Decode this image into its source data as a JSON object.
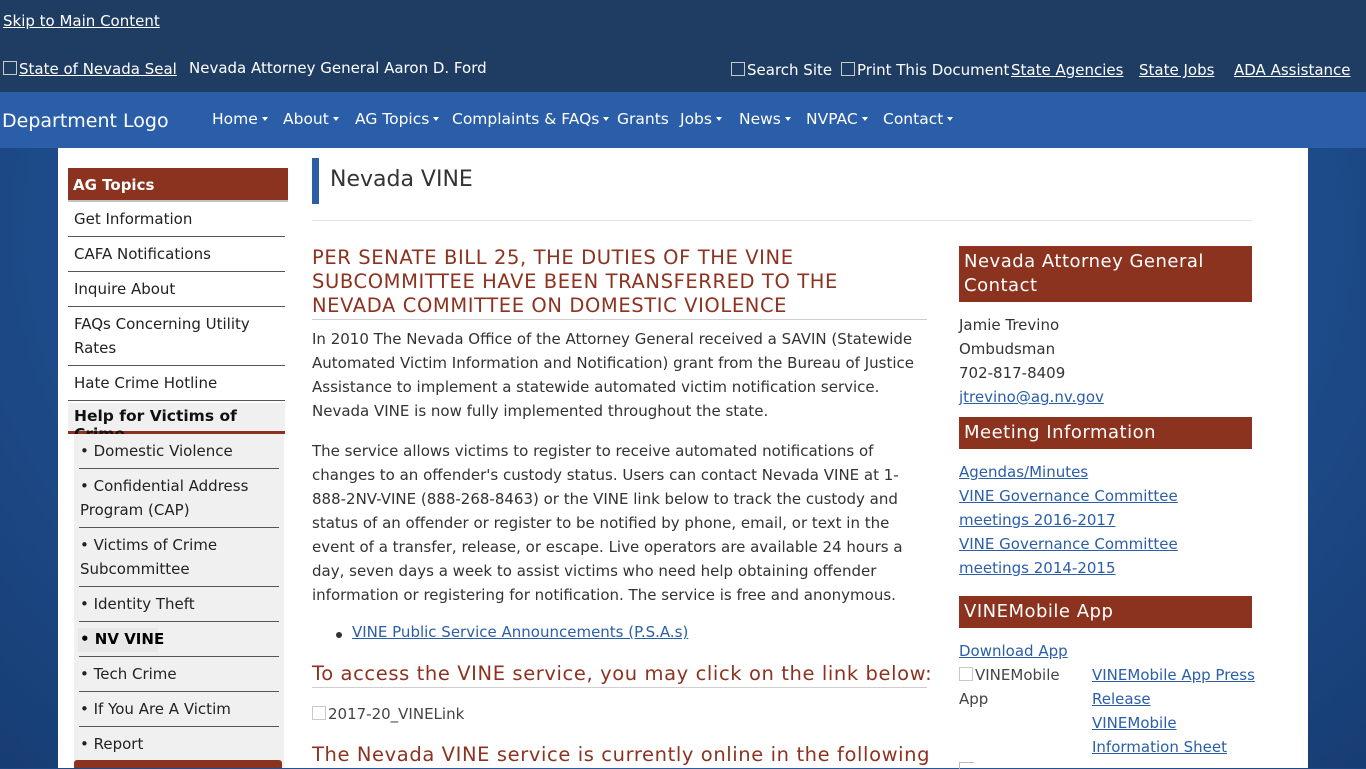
{
  "header": {
    "skip_link": "Skip to Main Content",
    "seal_alt": "State of Nevada Seal",
    "ag_title": "Nevada Attorney General Aaron D. Ford",
    "utilities": {
      "search_alt": "Search Site",
      "print_alt": "Print This Document",
      "state_agencies": "State Agencies",
      "state_jobs": "State Jobs",
      "ada": "ADA Assistance"
    }
  },
  "nav": {
    "logo_alt": "Department Logo",
    "items": [
      {
        "label": "Home"
      },
      {
        "label": "About"
      },
      {
        "label": "AG Topics"
      },
      {
        "label": "Complaints & FAQs"
      },
      {
        "label": "Grants"
      },
      {
        "label": "Jobs"
      },
      {
        "label": "News"
      },
      {
        "label": "NVPAC"
      },
      {
        "label": "Contact"
      }
    ]
  },
  "sidebar": {
    "heading": "AG Topics",
    "items": [
      {
        "label": "Get Information"
      },
      {
        "label": "CAFA Notifications"
      },
      {
        "label": "Inquire About"
      },
      {
        "label": "FAQs Concerning Utility Rates"
      },
      {
        "label": "Hate Crime Hotline"
      }
    ],
    "sub_heading": "Help for Victims of Crime",
    "sub_items": [
      {
        "label": "• Domestic Violence"
      },
      {
        "label": "• Confidential Address Program (CAP)"
      },
      {
        "label": "• Victims of Crime Subcommittee"
      },
      {
        "label": "• Identity Theft"
      },
      {
        "label": "• NV VINE"
      },
      {
        "label": "• Tech Crime"
      },
      {
        "label": "• If You Are A Victim"
      },
      {
        "label": "• Report"
      }
    ]
  },
  "main": {
    "page_title": "Nevada VINE",
    "heading": "PER SENATE BILL 25, THE DUTIES OF THE VINE SUBCOMMITTEE HAVE BEEN TRANSFERRED TO THE NEVADA COMMITTEE ON DOMESTIC VIOLENCE",
    "para1": "In 2010 The Nevada Office of the Attorney General received a SAVIN (Statewide Automated Victim Information and Notification) grant from the Bureau of Justice Assistance to implement a statewide automated victim notification service. Nevada VINE is now fully implemented throughout the state.",
    "para2": "The service allows victims to register to receive automated notifications of changes to an offender's custody status. Users can contact Nevada VINE at 1-888-2NV-VINE (888-268-8463) or the VINE link below to track the custody and status of an offender or register to be notified by phone, email, or text in the event of a transfer, release, or escape. Live operators are available 24 hours a day, seven days a week to assist victims who need help obtaining offender information or registering for notification. The service is free and anonymous.",
    "psa_link": "VINE Public Service Announcements (P.S.A.s)",
    "access_heading": "To access the VINE service, you may click on the link below:",
    "vine_link_alt": "2017-20_VINELink",
    "online_heading": "The Nevada VINE service is currently online in the following"
  },
  "right": {
    "contact_heading": "Nevada Attorney General Contact",
    "contact_name": "Jamie Trevino",
    "contact_role": "Ombudsman",
    "contact_phone": "702-817-8409",
    "contact_email": "jtrevino@ag.nv.gov",
    "meeting_heading": "Meeting Information",
    "meeting_links": [
      {
        "label": "Agendas/Minutes"
      },
      {
        "label": "VINE Governance Committee meetings 2016-2017"
      },
      {
        "label": "VINE Governance Committee meetings 2014-2015"
      }
    ],
    "app_heading": "VINEMobile App",
    "download_link": "Download App",
    "app_img_alt": "VINEMobile App",
    "app_press_link": "VINEMobile App Press Release",
    "app_info_link": "VINEMobile Information Sheet"
  }
}
